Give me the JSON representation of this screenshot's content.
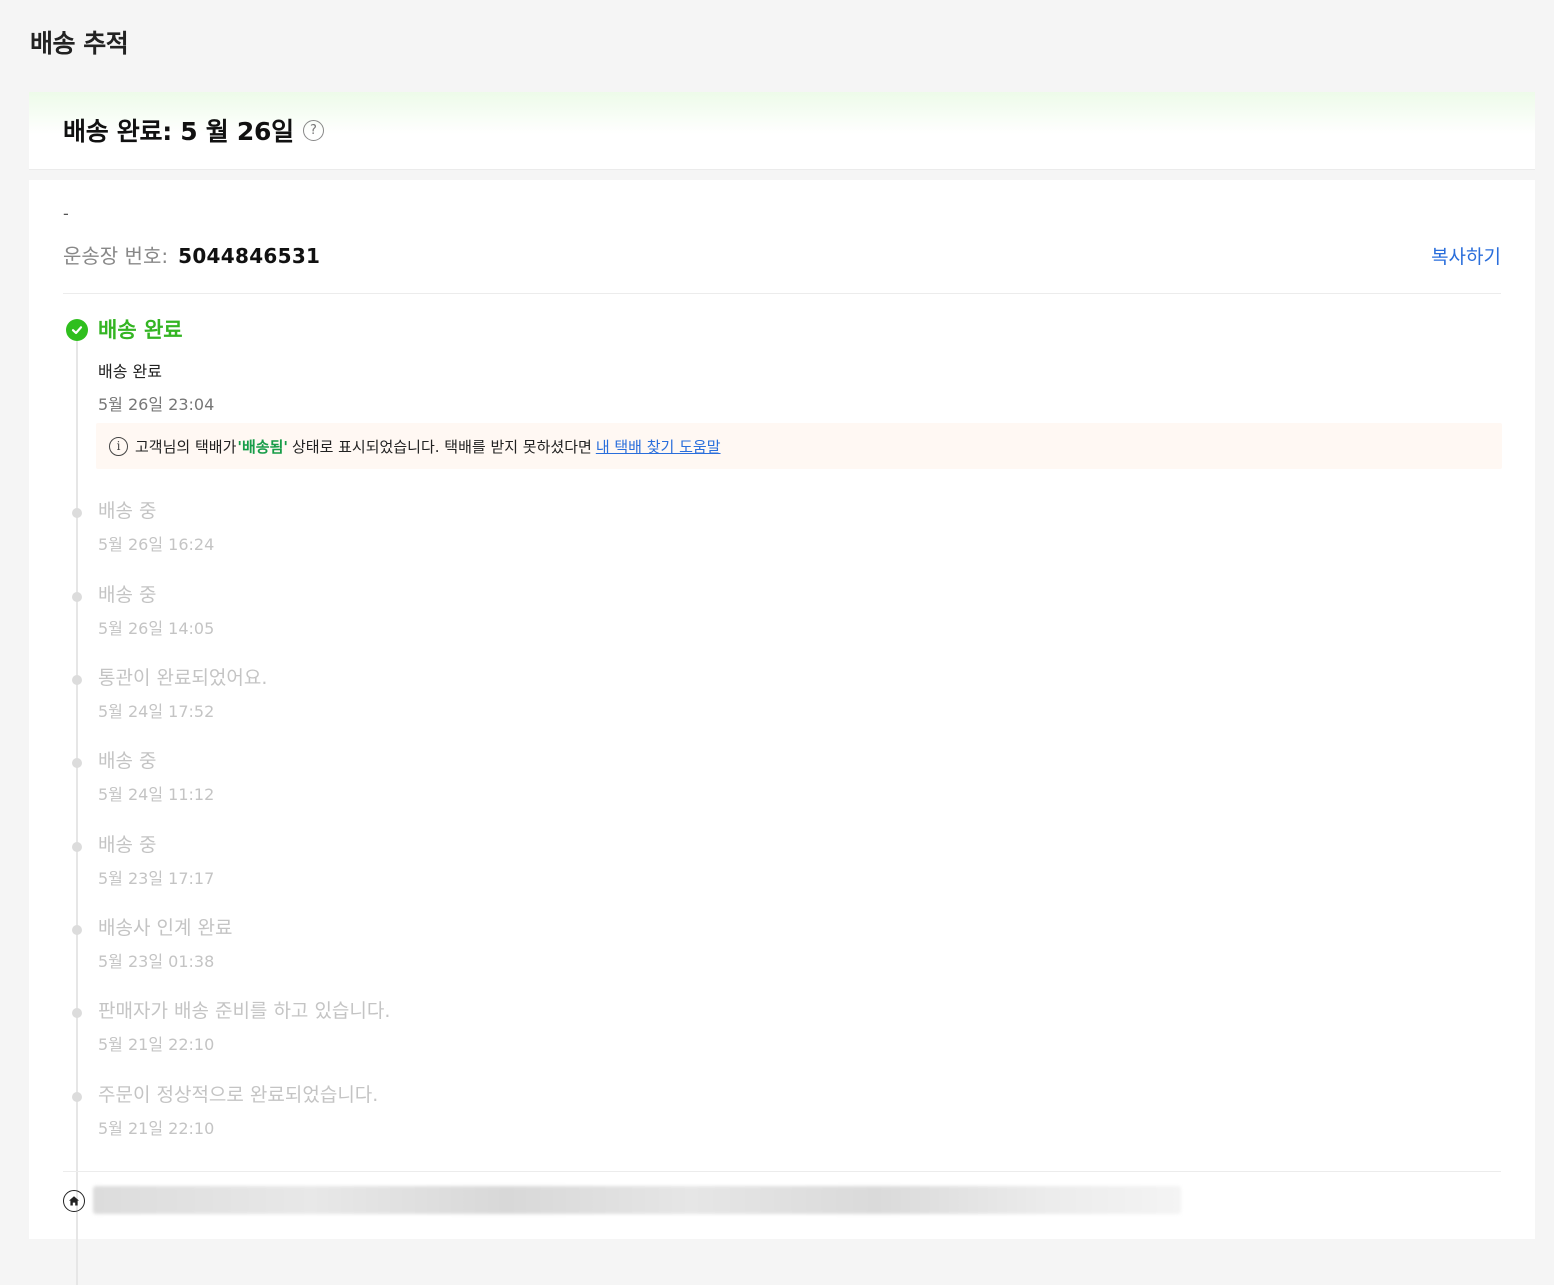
{
  "page": {
    "title": "배송 추적"
  },
  "status": {
    "headline": "배송 완료: 5 월 26일",
    "help_icon_text": "?"
  },
  "shipment": {
    "dash": "-",
    "tracking_label": "운송장 번호:",
    "tracking_number": "5044846531",
    "copy_label": "복사하기"
  },
  "current_event": {
    "title": "배송 완료",
    "description": "배송 완료",
    "time": "5월 26일 23:04"
  },
  "notice": {
    "icon_text": "i",
    "prefix": "고객님의 택배가",
    "highlight": "'배송됨'",
    "middle": "상태로 표시되었습니다. 택배를 받지 못하셨다면",
    "link": "내 택배 찾기 도움말"
  },
  "events": [
    {
      "title": "배송 중",
      "time": "5월 26일 16:24"
    },
    {
      "title": "배송 중",
      "time": "5월 26일 14:05"
    },
    {
      "title": "통관이 완료되었어요.",
      "time": "5월 24일 17:52"
    },
    {
      "title": "배송 중",
      "time": "5월 24일 11:12"
    },
    {
      "title": "배송 중",
      "time": "5월 23일 17:17"
    },
    {
      "title": "배송사 인계 완료",
      "time": "5월 23일 01:38"
    },
    {
      "title": "판매자가 배송 준비를 하고 있습니다.",
      "time": "5월 21일 22:10"
    },
    {
      "title": "주문이 정상적으로 완료되었습니다.",
      "time": "5월 21일 22:10"
    }
  ],
  "colors": {
    "accent_green": "#34b523",
    "link_blue": "#2a6edb",
    "notice_bg": "#fff8f3",
    "muted": "#c4c4c4"
  },
  "icons": {
    "status_help": "question-circle-icon",
    "current": "check-circle-icon",
    "notice": "info-circle-icon",
    "address": "home-icon"
  }
}
